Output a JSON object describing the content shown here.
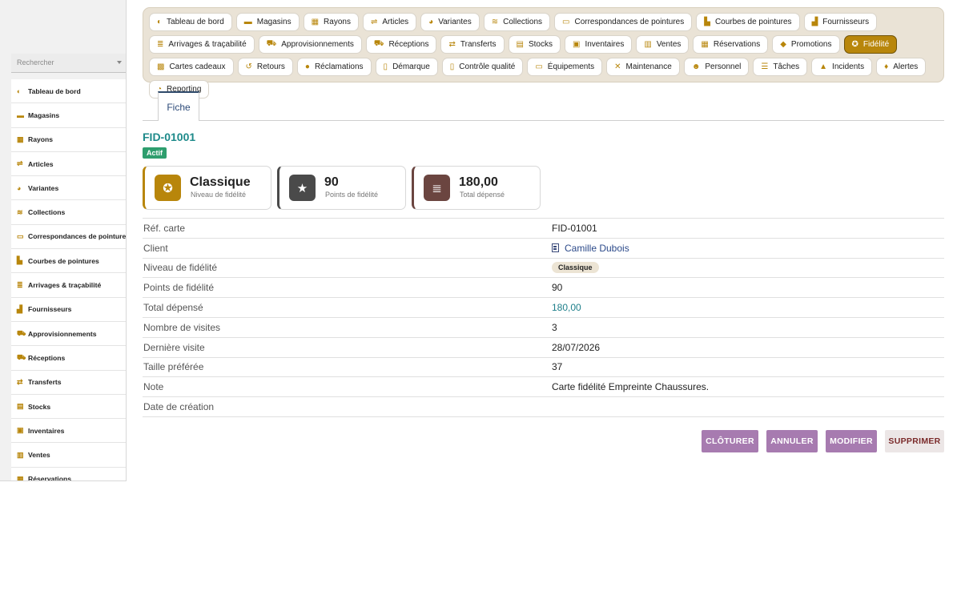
{
  "sidebar": {
    "search_placeholder": "Rechercher",
    "items": [
      {
        "label": "Tableau de bord",
        "icon": "gauge-icon",
        "glyph": "◐"
      },
      {
        "label": "Magasins",
        "icon": "store-icon",
        "glyph": "▬"
      },
      {
        "label": "Rayons",
        "icon": "grid-icon",
        "glyph": "▦"
      },
      {
        "label": "Articles",
        "icon": "tag-icon",
        "glyph": "⇌"
      },
      {
        "label": "Variantes",
        "icon": "palette-icon",
        "glyph": "◕"
      },
      {
        "label": "Collections",
        "icon": "layers-icon",
        "glyph": "≋"
      },
      {
        "label": "Correspondances de pointures",
        "icon": "ruler-icon",
        "glyph": "▭"
      },
      {
        "label": "Courbes de pointures",
        "icon": "chart-icon",
        "glyph": "▙"
      },
      {
        "label": "Arrivages & traçabilité",
        "icon": "barcode-icon",
        "glyph": "≣"
      },
      {
        "label": "Fournisseurs",
        "icon": "factory-icon",
        "glyph": "▟"
      },
      {
        "label": "Approvisionnements",
        "icon": "cart-icon",
        "glyph": "⛟"
      },
      {
        "label": "Réceptions",
        "icon": "truck-icon",
        "glyph": "⛟"
      },
      {
        "label": "Transferts",
        "icon": "swap-icon",
        "glyph": "⇄"
      },
      {
        "label": "Stocks",
        "icon": "box-icon",
        "glyph": "▤"
      },
      {
        "label": "Inventaires",
        "icon": "clipboard-icon",
        "glyph": "▣"
      },
      {
        "label": "Ventes",
        "icon": "cash-register-icon",
        "glyph": "▥"
      },
      {
        "label": "Réservations",
        "icon": "calendar-icon",
        "glyph": "▦"
      }
    ]
  },
  "topnav": [
    {
      "label": "Tableau de bord",
      "icon": "gauge-icon",
      "glyph": "◐",
      "active": false
    },
    {
      "label": "Magasins",
      "icon": "store-icon",
      "glyph": "▬",
      "active": false
    },
    {
      "label": "Rayons",
      "icon": "grid-icon",
      "glyph": "▦",
      "active": false
    },
    {
      "label": "Articles",
      "icon": "tag-icon",
      "glyph": "⇌",
      "active": false
    },
    {
      "label": "Variantes",
      "icon": "palette-icon",
      "glyph": "◕",
      "active": false
    },
    {
      "label": "Collections",
      "icon": "layers-icon",
      "glyph": "≋",
      "active": false
    },
    {
      "label": "Correspondances de pointures",
      "icon": "ruler-icon",
      "glyph": "▭",
      "active": false
    },
    {
      "label": "Courbes de pointures",
      "icon": "chart-icon",
      "glyph": "▙",
      "active": false
    },
    {
      "label": "Fournisseurs",
      "icon": "factory-icon",
      "glyph": "▟",
      "active": false
    },
    {
      "label": "Arrivages & traçabilité",
      "icon": "barcode-icon",
      "glyph": "≣",
      "active": false
    },
    {
      "label": "Approvisionnements",
      "icon": "cart-icon",
      "glyph": "⛟",
      "active": false
    },
    {
      "label": "Réceptions",
      "icon": "truck-icon",
      "glyph": "⛟",
      "active": false
    },
    {
      "label": "Transferts",
      "icon": "swap-icon",
      "glyph": "⇄",
      "active": false
    },
    {
      "label": "Stocks",
      "icon": "box-icon",
      "glyph": "▤",
      "active": false
    },
    {
      "label": "Inventaires",
      "icon": "clipboard-icon",
      "glyph": "▣",
      "active": false
    },
    {
      "label": "Ventes",
      "icon": "cash-register-icon",
      "glyph": "▥",
      "active": false
    },
    {
      "label": "Réservations",
      "icon": "calendar-icon",
      "glyph": "▦",
      "active": false
    },
    {
      "label": "Promotions",
      "icon": "tags-icon",
      "glyph": "◆",
      "active": false
    },
    {
      "label": "Fidélité",
      "icon": "award-icon",
      "glyph": "✪",
      "active": true
    },
    {
      "label": "Cartes cadeaux",
      "icon": "gift-icon",
      "glyph": "▩",
      "active": false
    },
    {
      "label": "Retours",
      "icon": "undo-icon",
      "glyph": "↺",
      "active": false
    },
    {
      "label": "Réclamations",
      "icon": "comment-icon",
      "glyph": "●",
      "active": false
    },
    {
      "label": "Démarque",
      "icon": "file-icon",
      "glyph": "▯",
      "active": false
    },
    {
      "label": "Contrôle qualité",
      "icon": "clipboard-check-icon",
      "glyph": "▯",
      "active": false
    },
    {
      "label": "Équipements",
      "icon": "monitor-icon",
      "glyph": "▭",
      "active": false
    },
    {
      "label": "Maintenance",
      "icon": "tools-icon",
      "glyph": "✕",
      "active": false
    },
    {
      "label": "Personnel",
      "icon": "users-icon",
      "glyph": "☻",
      "active": false
    },
    {
      "label": "Tâches",
      "icon": "list-icon",
      "glyph": "☰",
      "active": false
    },
    {
      "label": "Incidents",
      "icon": "warning-icon",
      "glyph": "▲",
      "active": false
    },
    {
      "label": "Alertes",
      "icon": "bell-icon",
      "glyph": "♦",
      "active": false
    },
    {
      "label": "Reporting",
      "icon": "pie-chart-icon",
      "glyph": "◔",
      "active": false
    }
  ],
  "tab": {
    "label": "Fiche"
  },
  "record": {
    "title": "FID-01001",
    "status": "Actif"
  },
  "cards": [
    {
      "value": "Classique",
      "label": "Niveau de fidélité",
      "icon": "award-icon",
      "glyph": "✪",
      "color": "#b8860b"
    },
    {
      "value": "90",
      "label": "Points de fidélité",
      "icon": "star-icon",
      "glyph": "★",
      "color": "#4a4a4a"
    },
    {
      "value": "180,00",
      "label": "Total dépensé",
      "icon": "coins-icon",
      "glyph": "≣",
      "color": "#6b4540"
    }
  ],
  "fields": [
    {
      "key": "Réf. carte",
      "value": "FID-01001",
      "kind": "text"
    },
    {
      "key": "Client",
      "value": "Camille Dubois",
      "kind": "link"
    },
    {
      "key": "Niveau de fidélité",
      "value": "Classique",
      "kind": "pill"
    },
    {
      "key": "Points de fidélité",
      "value": "90",
      "kind": "text"
    },
    {
      "key": "Total dépensé",
      "value": "180,00",
      "kind": "money"
    },
    {
      "key": "Nombre de visites",
      "value": "3",
      "kind": "text"
    },
    {
      "key": "Dernière visite",
      "value": "28/07/2026",
      "kind": "text"
    },
    {
      "key": "Taille préférée",
      "value": "37",
      "kind": "text"
    },
    {
      "key": "Note",
      "value": "Carte fidélité Empreinte Chaussures.",
      "kind": "text"
    },
    {
      "key": "Date de création",
      "value": "",
      "kind": "text"
    }
  ],
  "actions": {
    "close": "CLÔTURER",
    "cancel": "ANNULER",
    "edit": "MODIFIER",
    "delete": "SUPPRIMER"
  }
}
